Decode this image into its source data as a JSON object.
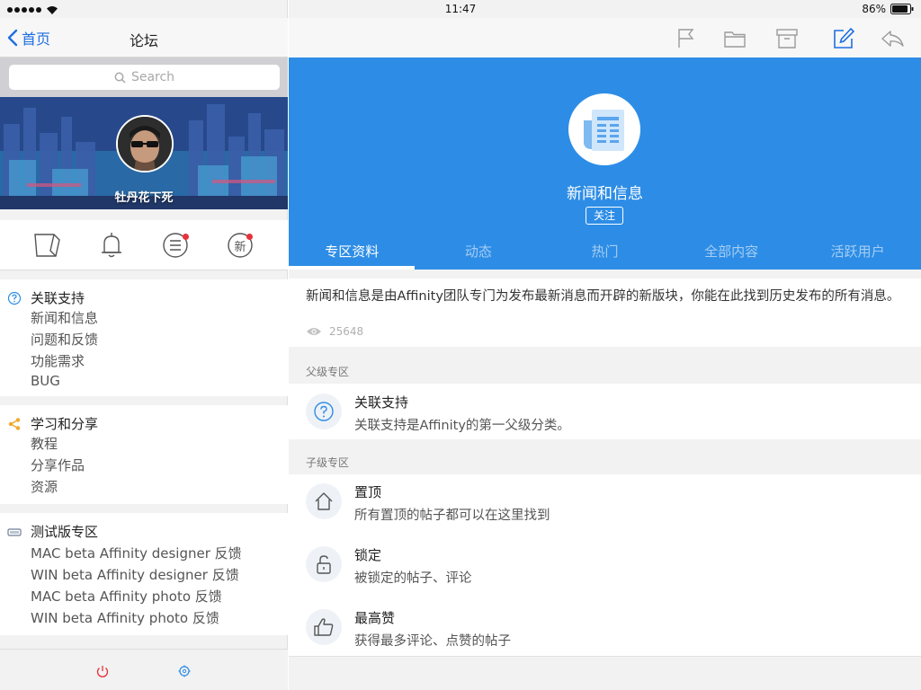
{
  "status_bar": {
    "time": "11:47",
    "battery": "86%"
  },
  "left_nav": {
    "back_label": "首页",
    "title": "论坛"
  },
  "search": {
    "placeholder": "Search"
  },
  "profile": {
    "username": "牡丹花下死"
  },
  "quickbar": {
    "new_badge_label": "新"
  },
  "groups": [
    {
      "title": "关联支持",
      "icon": "question-icon",
      "items": [
        "新闻和信息",
        "问题和反馈",
        "功能需求",
        "BUG"
      ]
    },
    {
      "title": "学习和分享",
      "icon": "share-icon",
      "items": [
        "教程",
        "分享作品",
        "资源"
      ]
    },
    {
      "title": "测试版专区",
      "icon": "beta-icon",
      "items": [
        "MAC beta Affinity designer 反馈",
        "WIN  beta Affinity designer 反馈",
        "MAC beta Affinity photo 反馈",
        "WIN  beta Affinity photo 反馈"
      ]
    }
  ],
  "forum": {
    "title": "新闻和信息",
    "follow_label": "关注",
    "tabs": [
      "专区资料",
      "动态",
      "热门",
      "全部内容",
      "活跃用户"
    ],
    "active_tab": "专区资料",
    "description": "新闻和信息是由Affinity团队专门为发布最新消息而开辟的新版块，你能在此找到历史发布的所有消息。",
    "views": "25648",
    "parent_label": "父级专区",
    "parent": {
      "title": "关联支持",
      "subtitle": "关联支持是Affinity的第一父级分类。",
      "icon": "question-icon"
    },
    "child_label": "子级专区",
    "children": [
      {
        "title": "置顶",
        "subtitle": "所有置顶的帖子都可以在这里找到",
        "icon": "home-icon"
      },
      {
        "title": "锁定",
        "subtitle": "被锁定的帖子、评论",
        "icon": "lock-icon"
      },
      {
        "title": "最高赞",
        "subtitle": "获得最多评论、点赞的帖子",
        "icon": "thumbs-up-icon"
      }
    ]
  },
  "colors": {
    "accent": "#2d8de6",
    "link": "#1f6fe0",
    "badge": "#e8323a",
    "share": "#f2a72b"
  }
}
